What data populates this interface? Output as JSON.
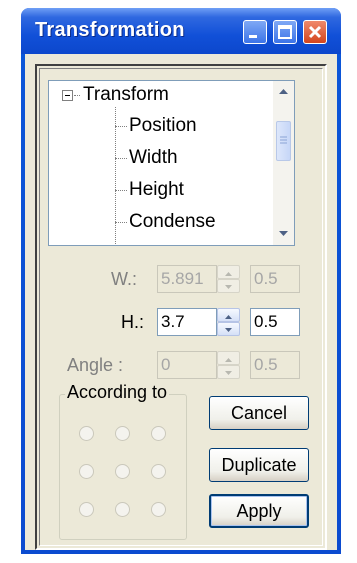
{
  "window": {
    "title": "Transformation",
    "controls": {
      "minimize_icon": "minimize-icon",
      "maximize_icon": "maximize-icon",
      "close_icon": "close-icon"
    }
  },
  "tree": {
    "items": [
      {
        "label": "Transform",
        "level": 0,
        "expanded": true
      },
      {
        "label": "Position",
        "level": 1
      },
      {
        "label": "Width",
        "level": 1
      },
      {
        "label": "Height",
        "level": 1
      },
      {
        "label": "Condense",
        "level": 1
      }
    ]
  },
  "fields": {
    "width": {
      "label": "W.:",
      "value": "5.891",
      "step": "0.5",
      "enabled": false
    },
    "height": {
      "label": "H.:",
      "value": "3.7",
      "step": "0.5",
      "enabled": true
    },
    "angle": {
      "label": "Angle :",
      "value": "0",
      "step": "0.5",
      "enabled": false
    }
  },
  "according_to": {
    "label": "According to",
    "grid_rows": 3,
    "grid_cols": 3,
    "enabled": false
  },
  "buttons": {
    "cancel": "Cancel",
    "duplicate": "Duplicate",
    "apply": "Apply"
  },
  "colors": {
    "titlebar": "#1150d8",
    "close_button": "#d4451e",
    "dialog_bg": "#ece9d8"
  }
}
